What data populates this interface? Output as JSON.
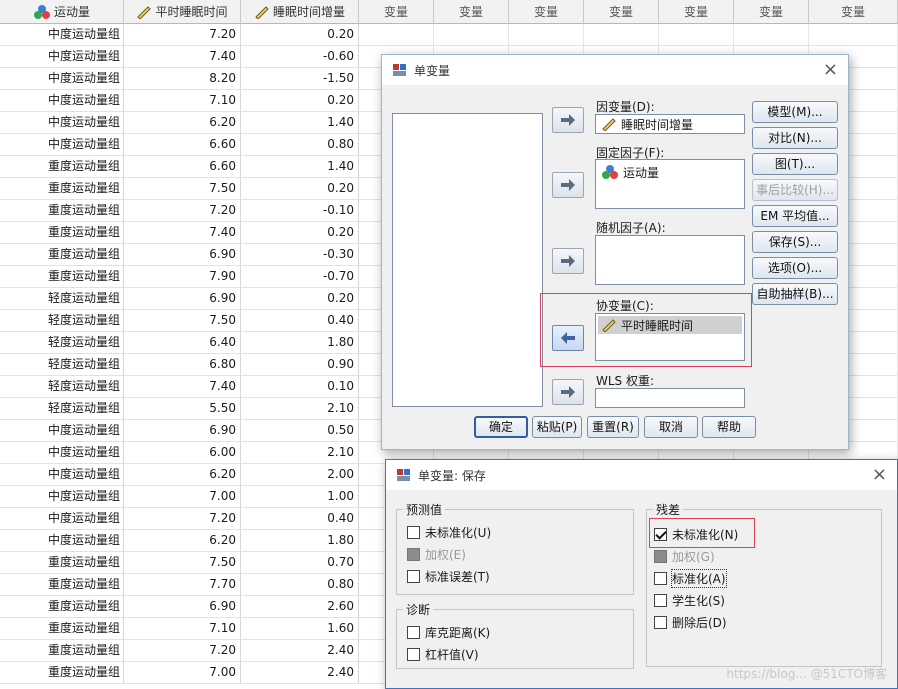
{
  "sheet": {
    "headers": [
      "运动量",
      "平时睡眠时间",
      "睡眠时间增量",
      "变量",
      "变量",
      "变量",
      "变量",
      "变量",
      "变量",
      "变量"
    ],
    "rows": [
      [
        "中度运动量组",
        "7.20",
        "0.20"
      ],
      [
        "中度运动量组",
        "7.40",
        "-0.60"
      ],
      [
        "中度运动量组",
        "8.20",
        "-1.50"
      ],
      [
        "中度运动量组",
        "7.10",
        "0.20"
      ],
      [
        "中度运动量组",
        "6.20",
        "1.40"
      ],
      [
        "中度运动量组",
        "6.60",
        "0.80"
      ],
      [
        "重度运动量组",
        "6.60",
        "1.40"
      ],
      [
        "重度运动量组",
        "7.50",
        "0.20"
      ],
      [
        "重度运动量组",
        "7.20",
        "-0.10"
      ],
      [
        "重度运动量组",
        "7.40",
        "0.20"
      ],
      [
        "重度运动量组",
        "6.90",
        "-0.30"
      ],
      [
        "重度运动量组",
        "7.90",
        "-0.70"
      ],
      [
        "轻度运动量组",
        "6.90",
        "0.20"
      ],
      [
        "轻度运动量组",
        "7.50",
        "0.40"
      ],
      [
        "轻度运动量组",
        "6.40",
        "1.80"
      ],
      [
        "轻度运动量组",
        "6.80",
        "0.90"
      ],
      [
        "轻度运动量组",
        "7.40",
        "0.10"
      ],
      [
        "轻度运动量组",
        "5.50",
        "2.10"
      ],
      [
        "中度运动量组",
        "6.90",
        "0.50"
      ],
      [
        "中度运动量组",
        "6.00",
        "2.10"
      ],
      [
        "中度运动量组",
        "6.20",
        "2.00"
      ],
      [
        "中度运动量组",
        "7.00",
        "1.00"
      ],
      [
        "中度运动量组",
        "7.20",
        "0.40"
      ],
      [
        "中度运动量组",
        "6.20",
        "1.80"
      ],
      [
        "重度运动量组",
        "7.50",
        "0.70"
      ],
      [
        "重度运动量组",
        "7.70",
        "0.80"
      ],
      [
        "重度运动量组",
        "6.90",
        "2.60"
      ],
      [
        "重度运动量组",
        "7.10",
        "1.60"
      ],
      [
        "重度运动量组",
        "7.20",
        "2.40"
      ],
      [
        "重度运动量组",
        "7.00",
        "2.40"
      ]
    ]
  },
  "univariate": {
    "title": "单变量",
    "dependent_label": "因变量(D):",
    "dependent_value": "睡眠时间增量",
    "fixed_label": "固定因子(F):",
    "fixed_value": "运动量",
    "random_label": "随机因子(A):",
    "covariate_label": "协变量(C):",
    "covariate_value": "平时睡眠时间",
    "wls_label": "WLS 权重:",
    "side_buttons": [
      "模型(M)...",
      "对比(N)...",
      "图(T)...",
      "事后比较(H)...",
      "EM 平均值...",
      "保存(S)...",
      "选项(O)...",
      "自助抽样(B)..."
    ],
    "bottom_buttons": [
      "确定",
      "粘贴(P)",
      "重置(R)",
      "取消",
      "帮助"
    ]
  },
  "save": {
    "title": "单变量: 保存",
    "predicted_title": "预测值",
    "predicted": [
      "未标准化(U)",
      "加权(E)",
      "标准误差(T)"
    ],
    "diagnostics_title": "诊断",
    "diagnostics": [
      "库克距离(K)",
      "杠杆值(V)"
    ],
    "residuals_title": "残差",
    "residuals": [
      "未标准化(N)",
      "加权(G)",
      "标准化(A)",
      "学生化(S)",
      "删除后(D)"
    ],
    "watermark": "https://blog... @51CTO博客"
  },
  "colors": {
    "accent": "#2f5fa0",
    "highlight": "#e0405a"
  }
}
